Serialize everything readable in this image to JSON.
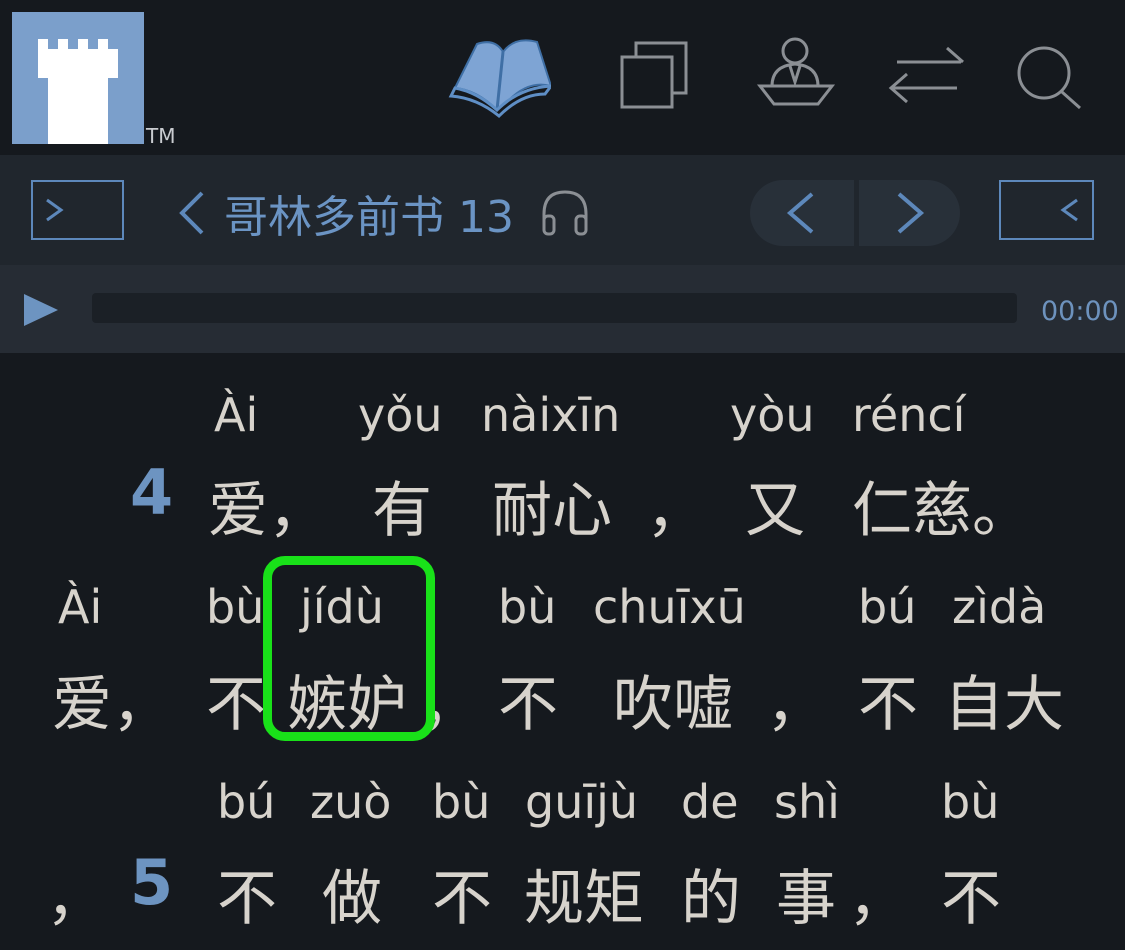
{
  "header": {
    "logo_icon": "castle-tower-icon",
    "trademark": "TM",
    "icons": [
      "book-icon",
      "copy-icon",
      "person-at-desk-icon",
      "swap-arrows-icon",
      "search-icon"
    ],
    "accent_color": "#6b94c4"
  },
  "nav": {
    "left_panel_icon": "open-left-panel-icon",
    "back_icon": "chevron-left-icon",
    "title": "哥林多前书 13",
    "audio_icon": "headphones-icon",
    "prev_icon": "chevron-left-icon",
    "next_icon": "chevron-right-icon",
    "right_panel_icon": "open-right-panel-icon"
  },
  "audio": {
    "play_icon": "play-icon",
    "time": "00:00",
    "progress": 0
  },
  "passage": {
    "line1": {
      "verse": "4",
      "words": [
        {
          "py": "Ài",
          "zh": "爱，"
        },
        {
          "py": "yǒu",
          "zh": "有"
        },
        {
          "py": "nàixīn",
          "zh": "耐心"
        },
        {
          "py": "",
          "zh": "，"
        },
        {
          "py": "yòu",
          "zh": "又"
        },
        {
          "py": "réncí",
          "zh": "仁慈。"
        }
      ]
    },
    "line2": {
      "words": [
        {
          "py": "Ài",
          "zh": "爱，"
        },
        {
          "py": "bù",
          "zh": "不"
        },
        {
          "py": "jídù",
          "zh": "嫉妒"
        },
        {
          "py": "",
          "zh": "，"
        },
        {
          "py": "bù",
          "zh": "不"
        },
        {
          "py": "chuīxū",
          "zh": "吹嘘"
        },
        {
          "py": "",
          "zh": "，"
        },
        {
          "py": "bú",
          "zh": "不"
        },
        {
          "py": "zìdà",
          "zh": "自大"
        }
      ]
    },
    "line3": {
      "verse": "5",
      "words": [
        {
          "py": "",
          "zh": "，"
        },
        {
          "py": "bú",
          "zh": "不"
        },
        {
          "py": "zuò",
          "zh": "做"
        },
        {
          "py": "bù",
          "zh": "不"
        },
        {
          "py": "guījù",
          "zh": "规矩"
        },
        {
          "py": "de",
          "zh": "的"
        },
        {
          "py": "shì",
          "zh": "事"
        },
        {
          "py": "",
          "zh": "，"
        },
        {
          "py": "bù",
          "zh": "不"
        }
      ]
    },
    "highlight_color": "#19e119"
  }
}
